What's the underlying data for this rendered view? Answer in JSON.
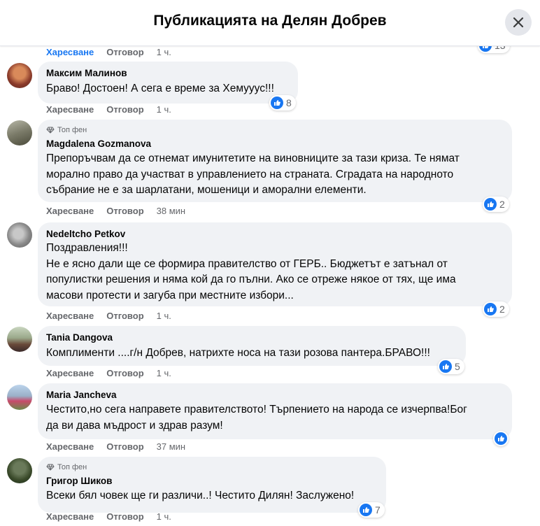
{
  "header": {
    "title": "Публикацията на Делян Добрев"
  },
  "labels": {
    "like": "Харесване",
    "reply": "Отговор",
    "top_fan": "Топ фен"
  },
  "prev_comment": {
    "time": "1 ч.",
    "reactions": "13"
  },
  "comments": [
    {
      "author": "Максим Малинов",
      "text": "Браво! Достоен! А сега е време за Хемууус!!!",
      "time": "1 ч.",
      "reactions": "8",
      "top_fan": false
    },
    {
      "author": "Magdalena Gozmanova",
      "text_lines": [
        "Препоръчвам да се отнемат имунитетите на виновниците за тази криза. Те нямат",
        "морално право да участват в управлението на страната. Сградата на народното",
        "събрание не е за шарлатани, мошеници и аморални елементи."
      ],
      "time": "38 мин",
      "reactions": "2",
      "top_fan": true
    },
    {
      "author": "Nedeltcho Petkov",
      "text_lines": [
        "Поздравления!!!",
        "Не е ясно дали ще се формира правителство от ГЕРБ.. Бюджетът е затънал от",
        "популистки решения и няма кой да го пълни. Ако се отреже някое от тях, ще има",
        "масови протести и загуба при местните избори..."
      ],
      "time": "1 ч.",
      "reactions": "2",
      "top_fan": false
    },
    {
      "author": "Tania Dangova",
      "text": "Комплименти ....г/н Добрев, натрихте носа на тази розова пантера.БРАВО!!!",
      "time": "1 ч.",
      "reactions": "5",
      "top_fan": false
    },
    {
      "author": "Maria Jancheva",
      "text_lines": [
        "Честито,но сега направете правителството! Търпението на народа се изчерпва!Бог",
        "да ви дава мъдрост и здрав разум!"
      ],
      "time": "37 мин",
      "reactions": "",
      "top_fan": false
    },
    {
      "author": "Григор Шиков",
      "text": "Всеки бял човек ще ги различи..! Честито Дилян! Заслужено!",
      "time": "1 ч.",
      "reactions": "7",
      "top_fan": true
    }
  ],
  "colors": {
    "accent": "#1877f2",
    "bubble": "#f0f2f5",
    "muted": "#65676b"
  }
}
